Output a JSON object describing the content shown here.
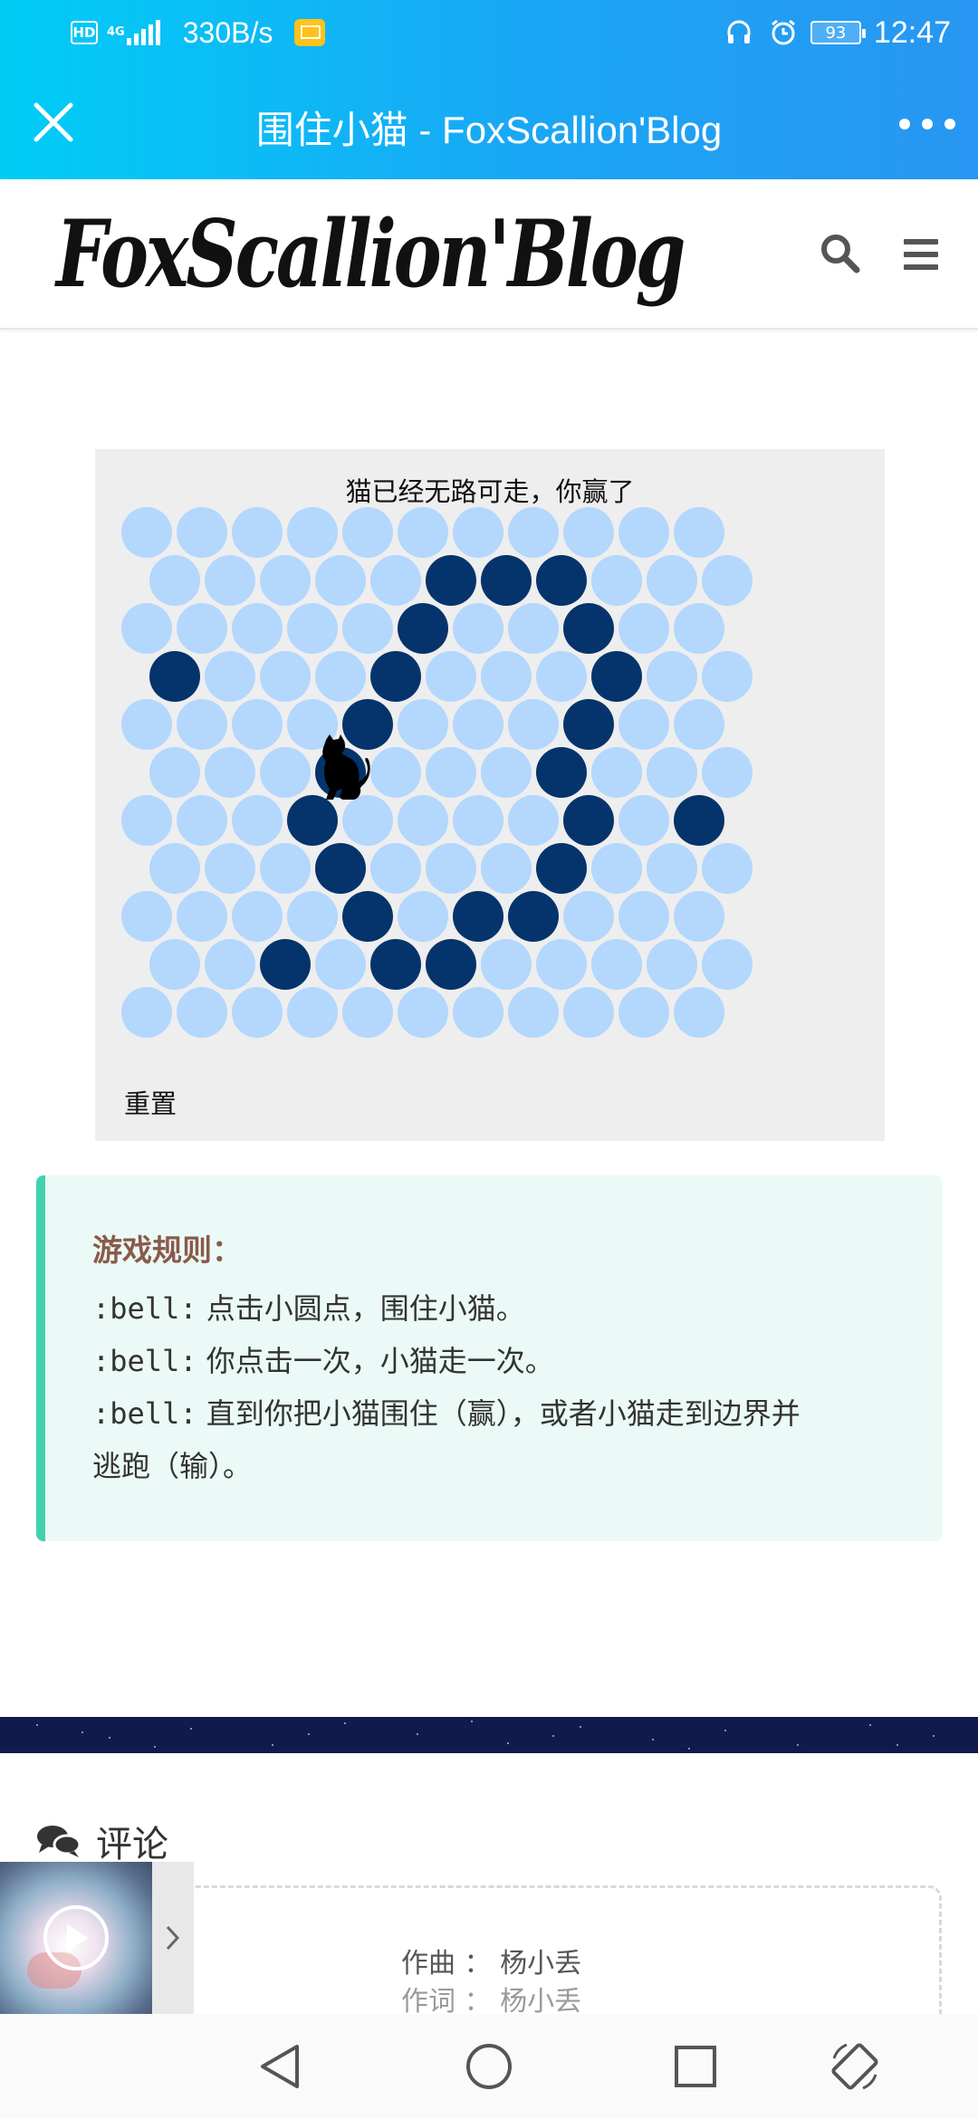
{
  "status_bar": {
    "hd_badge": "HD",
    "network_type": "4G",
    "net_speed": "330B/s",
    "battery": "93",
    "time": "12:47"
  },
  "titlebar": {
    "title": "围住小猫 - FoxScallion'Blog"
  },
  "site": {
    "logo_text": "FoxScallion'Blog"
  },
  "game": {
    "status": "猫已经无路可走，你赢了",
    "reset_label": "重置",
    "rows": 11,
    "cols": 11,
    "walls": [
      [
        1,
        5
      ],
      [
        1,
        6
      ],
      [
        1,
        7
      ],
      [
        2,
        5
      ],
      [
        2,
        8
      ],
      [
        3,
        0
      ],
      [
        3,
        4
      ],
      [
        3,
        8
      ],
      [
        4,
        4
      ],
      [
        4,
        8
      ],
      [
        5,
        3
      ],
      [
        5,
        7
      ],
      [
        6,
        3
      ],
      [
        6,
        8
      ],
      [
        6,
        10
      ],
      [
        7,
        3
      ],
      [
        7,
        7
      ],
      [
        8,
        4
      ],
      [
        8,
        6
      ],
      [
        8,
        7
      ],
      [
        9,
        2
      ],
      [
        9,
        4
      ],
      [
        9,
        5
      ]
    ],
    "cat": [
      5,
      3
    ]
  },
  "rules": {
    "title": "游戏规则：",
    "items": [
      {
        "prefix": ":bell:",
        "text": "点击小圆点，围住小猫。"
      },
      {
        "prefix": ":bell:",
        "text": "你点击一次，小猫走一次。"
      },
      {
        "prefix": ":bell:",
        "text": "直到你把小猫围住（赢），或者小猫走到边界并"
      }
    ],
    "continuation": "逃跑（输）。"
  },
  "comments": {
    "label": "评论"
  },
  "lyrics": {
    "line1": "作曲 ： 杨小丢",
    "line2": "作词 ： 杨小丢"
  },
  "colors": {
    "accent_start": "#00cdf6",
    "accent_end": "#2896f2",
    "dot_empty": "#b3d7fd",
    "dot_wall": "#04346b",
    "rules_border": "#42d1b0",
    "rules_bg": "#ebfaf6"
  }
}
